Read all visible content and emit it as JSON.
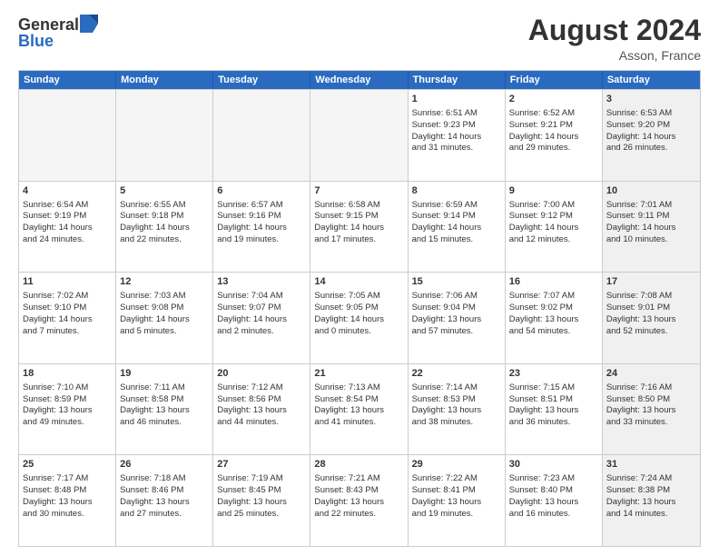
{
  "header": {
    "logo_general": "General",
    "logo_blue": "Blue",
    "month_title": "August 2024",
    "location": "Asson, France"
  },
  "weekdays": [
    "Sunday",
    "Monday",
    "Tuesday",
    "Wednesday",
    "Thursday",
    "Friday",
    "Saturday"
  ],
  "rows": [
    [
      {
        "day": "",
        "empty": true
      },
      {
        "day": "",
        "empty": true
      },
      {
        "day": "",
        "empty": true
      },
      {
        "day": "",
        "empty": true
      },
      {
        "day": "1",
        "lines": [
          "Sunrise: 6:51 AM",
          "Sunset: 9:23 PM",
          "Daylight: 14 hours",
          "and 31 minutes."
        ]
      },
      {
        "day": "2",
        "lines": [
          "Sunrise: 6:52 AM",
          "Sunset: 9:21 PM",
          "Daylight: 14 hours",
          "and 29 minutes."
        ]
      },
      {
        "day": "3",
        "lines": [
          "Sunrise: 6:53 AM",
          "Sunset: 9:20 PM",
          "Daylight: 14 hours",
          "and 26 minutes."
        ],
        "shaded": true
      }
    ],
    [
      {
        "day": "4",
        "lines": [
          "Sunrise: 6:54 AM",
          "Sunset: 9:19 PM",
          "Daylight: 14 hours",
          "and 24 minutes."
        ]
      },
      {
        "day": "5",
        "lines": [
          "Sunrise: 6:55 AM",
          "Sunset: 9:18 PM",
          "Daylight: 14 hours",
          "and 22 minutes."
        ]
      },
      {
        "day": "6",
        "lines": [
          "Sunrise: 6:57 AM",
          "Sunset: 9:16 PM",
          "Daylight: 14 hours",
          "and 19 minutes."
        ]
      },
      {
        "day": "7",
        "lines": [
          "Sunrise: 6:58 AM",
          "Sunset: 9:15 PM",
          "Daylight: 14 hours",
          "and 17 minutes."
        ]
      },
      {
        "day": "8",
        "lines": [
          "Sunrise: 6:59 AM",
          "Sunset: 9:14 PM",
          "Daylight: 14 hours",
          "and 15 minutes."
        ]
      },
      {
        "day": "9",
        "lines": [
          "Sunrise: 7:00 AM",
          "Sunset: 9:12 PM",
          "Daylight: 14 hours",
          "and 12 minutes."
        ]
      },
      {
        "day": "10",
        "lines": [
          "Sunrise: 7:01 AM",
          "Sunset: 9:11 PM",
          "Daylight: 14 hours",
          "and 10 minutes."
        ],
        "shaded": true
      }
    ],
    [
      {
        "day": "11",
        "lines": [
          "Sunrise: 7:02 AM",
          "Sunset: 9:10 PM",
          "Daylight: 14 hours",
          "and 7 minutes."
        ]
      },
      {
        "day": "12",
        "lines": [
          "Sunrise: 7:03 AM",
          "Sunset: 9:08 PM",
          "Daylight: 14 hours",
          "and 5 minutes."
        ]
      },
      {
        "day": "13",
        "lines": [
          "Sunrise: 7:04 AM",
          "Sunset: 9:07 PM",
          "Daylight: 14 hours",
          "and 2 minutes."
        ]
      },
      {
        "day": "14",
        "lines": [
          "Sunrise: 7:05 AM",
          "Sunset: 9:05 PM",
          "Daylight: 14 hours",
          "and 0 minutes."
        ]
      },
      {
        "day": "15",
        "lines": [
          "Sunrise: 7:06 AM",
          "Sunset: 9:04 PM",
          "Daylight: 13 hours",
          "and 57 minutes."
        ]
      },
      {
        "day": "16",
        "lines": [
          "Sunrise: 7:07 AM",
          "Sunset: 9:02 PM",
          "Daylight: 13 hours",
          "and 54 minutes."
        ]
      },
      {
        "day": "17",
        "lines": [
          "Sunrise: 7:08 AM",
          "Sunset: 9:01 PM",
          "Daylight: 13 hours",
          "and 52 minutes."
        ],
        "shaded": true
      }
    ],
    [
      {
        "day": "18",
        "lines": [
          "Sunrise: 7:10 AM",
          "Sunset: 8:59 PM",
          "Daylight: 13 hours",
          "and 49 minutes."
        ]
      },
      {
        "day": "19",
        "lines": [
          "Sunrise: 7:11 AM",
          "Sunset: 8:58 PM",
          "Daylight: 13 hours",
          "and 46 minutes."
        ]
      },
      {
        "day": "20",
        "lines": [
          "Sunrise: 7:12 AM",
          "Sunset: 8:56 PM",
          "Daylight: 13 hours",
          "and 44 minutes."
        ]
      },
      {
        "day": "21",
        "lines": [
          "Sunrise: 7:13 AM",
          "Sunset: 8:54 PM",
          "Daylight: 13 hours",
          "and 41 minutes."
        ]
      },
      {
        "day": "22",
        "lines": [
          "Sunrise: 7:14 AM",
          "Sunset: 8:53 PM",
          "Daylight: 13 hours",
          "and 38 minutes."
        ]
      },
      {
        "day": "23",
        "lines": [
          "Sunrise: 7:15 AM",
          "Sunset: 8:51 PM",
          "Daylight: 13 hours",
          "and 36 minutes."
        ]
      },
      {
        "day": "24",
        "lines": [
          "Sunrise: 7:16 AM",
          "Sunset: 8:50 PM",
          "Daylight: 13 hours",
          "and 33 minutes."
        ],
        "shaded": true
      }
    ],
    [
      {
        "day": "25",
        "lines": [
          "Sunrise: 7:17 AM",
          "Sunset: 8:48 PM",
          "Daylight: 13 hours",
          "and 30 minutes."
        ]
      },
      {
        "day": "26",
        "lines": [
          "Sunrise: 7:18 AM",
          "Sunset: 8:46 PM",
          "Daylight: 13 hours",
          "and 27 minutes."
        ]
      },
      {
        "day": "27",
        "lines": [
          "Sunrise: 7:19 AM",
          "Sunset: 8:45 PM",
          "Daylight: 13 hours",
          "and 25 minutes."
        ]
      },
      {
        "day": "28",
        "lines": [
          "Sunrise: 7:21 AM",
          "Sunset: 8:43 PM",
          "Daylight: 13 hours",
          "and 22 minutes."
        ]
      },
      {
        "day": "29",
        "lines": [
          "Sunrise: 7:22 AM",
          "Sunset: 8:41 PM",
          "Daylight: 13 hours",
          "and 19 minutes."
        ]
      },
      {
        "day": "30",
        "lines": [
          "Sunrise: 7:23 AM",
          "Sunset: 8:40 PM",
          "Daylight: 13 hours",
          "and 16 minutes."
        ]
      },
      {
        "day": "31",
        "lines": [
          "Sunrise: 7:24 AM",
          "Sunset: 8:38 PM",
          "Daylight: 13 hours",
          "and 14 minutes."
        ],
        "shaded": true
      }
    ]
  ]
}
